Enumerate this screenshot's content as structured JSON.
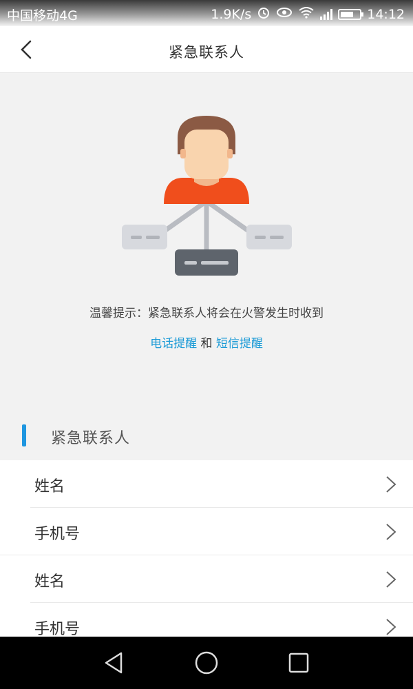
{
  "status_bar": {
    "carrier": "中国移动4G",
    "speed": "1.9K/s",
    "network": "4G",
    "time": "14:12"
  },
  "nav": {
    "title": "紧急联系人",
    "back_icon": "chevron-left-icon"
  },
  "tip": {
    "line1": "温馨提示：紧急联系人将会在火警发生时收到",
    "phone_reminder": "电话提醒",
    "and": "和",
    "sms_reminder": "短信提醒"
  },
  "section": {
    "title": "紧急联系人"
  },
  "contacts": [
    {
      "name_label": "姓名",
      "phone_label": "手机号"
    },
    {
      "name_label": "姓名",
      "phone_label": "手机号"
    }
  ],
  "colors": {
    "accent": "#1e96e0",
    "link": "#1a9ad6",
    "shirt": "#f04e1c",
    "hair": "#8b5a44",
    "face": "#f9d4ae"
  }
}
